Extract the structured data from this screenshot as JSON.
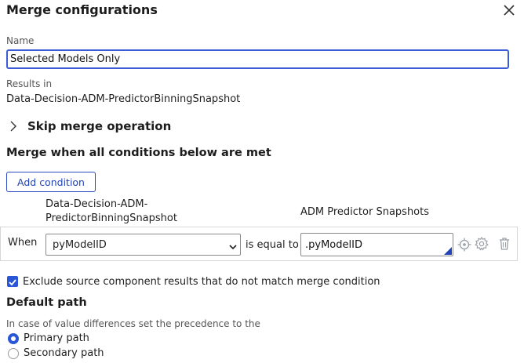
{
  "dialog": {
    "title": "Merge configurations",
    "close_icon": "close-icon"
  },
  "name_field": {
    "label": "Name",
    "value": "Selected Models Only"
  },
  "results": {
    "label": "Results in",
    "value": "Data-Decision-ADM-PredictorBinningSnapshot"
  },
  "skip_merge": {
    "label": "Skip merge operation",
    "icon": "chevron-right-icon"
  },
  "conditions": {
    "heading": "Merge when all conditions below are met",
    "add_button": "Add condition",
    "column_left_line1": "Data-Decision-ADM-",
    "column_left_line2": "PredictorBinningSnapshot",
    "column_right": "ADM Predictor Snapshots",
    "row": {
      "when_label": "When",
      "left_value": "pyModelID",
      "operator": "is equal to",
      "right_value": ".pyModelID",
      "icons": [
        "target-icon",
        "gear-icon",
        "trash-icon"
      ]
    }
  },
  "exclude": {
    "checked": true,
    "label": "Exclude source component results that do not match merge condition"
  },
  "default_path": {
    "heading": "Default path",
    "hint": "In case of value differences set the precedence to the",
    "options": [
      {
        "label": "Primary path",
        "selected": true
      },
      {
        "label": "Secondary path",
        "selected": false
      }
    ]
  },
  "colors": {
    "accent": "#2a56d8",
    "border": "#8a8a8a",
    "icon_gray": "#9aa0a6"
  }
}
